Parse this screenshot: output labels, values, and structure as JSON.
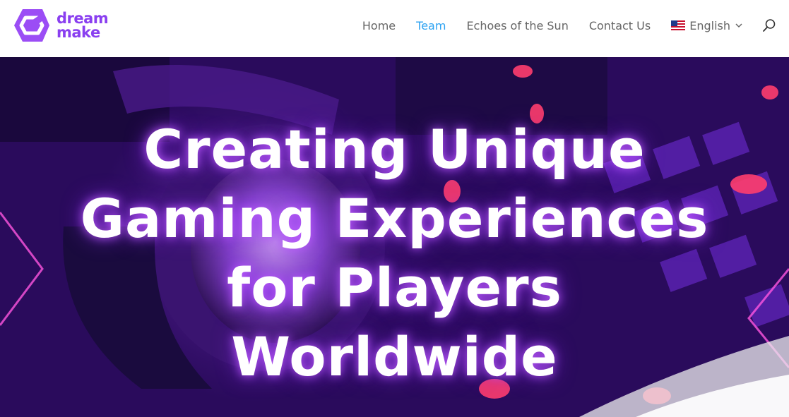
{
  "brand": {
    "logo_line1": "dream",
    "logo_line2": "make",
    "logo_color": "#8a3ff0"
  },
  "nav": {
    "items": [
      {
        "label": "Home",
        "active": false
      },
      {
        "label": "Team",
        "active": true
      },
      {
        "label": "Echoes of the Sun",
        "active": false
      },
      {
        "label": "Contact Us",
        "active": false
      }
    ],
    "language": {
      "label": "English",
      "flag_icon": "us-flag-icon"
    },
    "search_icon": "search-icon",
    "text_color": "#666666",
    "active_color": "#2ea3f2"
  },
  "hero": {
    "title_lines": [
      "Creating Unique",
      "Gaming Experiences",
      "for Players",
      "Worldwide"
    ]
  }
}
